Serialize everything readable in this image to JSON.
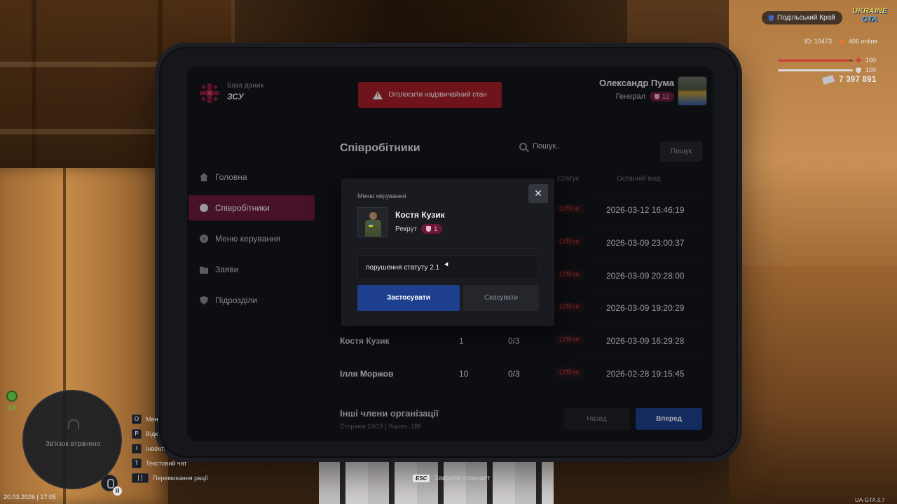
{
  "app": {
    "logo_subtitle": "База даних",
    "logo_title": "ЗСУ",
    "emergency_button": "Оголосити надзвичайний стан"
  },
  "user": {
    "name": "Олександр Пума",
    "rank": "Генерал",
    "level": "12"
  },
  "sidebar": {
    "items": [
      {
        "label": "Головна",
        "icon": "home-icon",
        "active": false
      },
      {
        "label": "Співробітники",
        "icon": "users-icon",
        "active": true
      },
      {
        "label": "Меню керування",
        "icon": "gear-icon",
        "active": false
      },
      {
        "label": "Заяви",
        "icon": "folder-icon",
        "active": false
      },
      {
        "label": "Підрозділи",
        "icon": "shield-icon",
        "active": false
      }
    ]
  },
  "main": {
    "title": "Співробітники",
    "search_placeholder": "Пошук..",
    "search_button": "Пошук",
    "columns": {
      "status": "Статус",
      "last_login": "Останній вхід"
    },
    "rows": [
      {
        "name": "",
        "rank": "",
        "warns": "",
        "status": "Offline",
        "last_login": "2026-03-12 16:46:19"
      },
      {
        "name": "",
        "rank": "",
        "warns": "",
        "status": "Offline",
        "last_login": "2026-03-09 23:00:37"
      },
      {
        "name": "",
        "rank": "",
        "warns": "",
        "status": "Offline",
        "last_login": "2026-03-09 20:28:00"
      },
      {
        "name": "",
        "rank": "",
        "warns": "",
        "status": "Offline",
        "last_login": "2026-03-09 19:20:29"
      },
      {
        "name": "Костя Кузик",
        "rank": "1",
        "warns": "0/3",
        "status": "Offline",
        "last_login": "2026-03-09 16:29:28"
      },
      {
        "name": "Ілля Моржов",
        "rank": "10",
        "warns": "0/3",
        "status": "Offline",
        "last_login": "2026-02-28 19:15:45"
      }
    ],
    "others_title": "Інші члени організації",
    "page_info": "Сторінка 19/19 | Усього: 186",
    "back_button": "Назад",
    "next_button": "Вперед"
  },
  "modal": {
    "title": "Меню керування",
    "close_icon": "close-icon",
    "member_name": "Костя Кузик",
    "member_rank": "Рекрут",
    "member_level": "1",
    "reason_value": "порушення статуту 2.1",
    "apply_button": "Застосувати",
    "cancel_button": "Скасувати"
  },
  "hud": {
    "server": "Подільський Край",
    "game_logo_top": "UKRAINE",
    "game_logo_bottom": "GTA",
    "id": "ID: 10473",
    "online": "406 online",
    "health": "100",
    "health_level": 0.95,
    "armor": "100",
    "armor_level": 1.0,
    "money": "7 397 891",
    "zone": "GZ",
    "radar_text": "Зв'язок втрачено",
    "mic_key": "Я",
    "datetime": "20.03.2026 | 17:05",
    "esc_key": "ESC",
    "esc_hint": "Закрити планшет",
    "version": "UA-GTA 3.7",
    "keybinds": [
      {
        "key": "O",
        "label": "Мен"
      },
      {
        "key": "P",
        "label": "Відк"
      },
      {
        "key": "I",
        "label": "Інвент."
      },
      {
        "key": "T",
        "label": "Текстовий чат"
      },
      {
        "key": "[  ]",
        "label": "Перемикання рації"
      }
    ]
  }
}
